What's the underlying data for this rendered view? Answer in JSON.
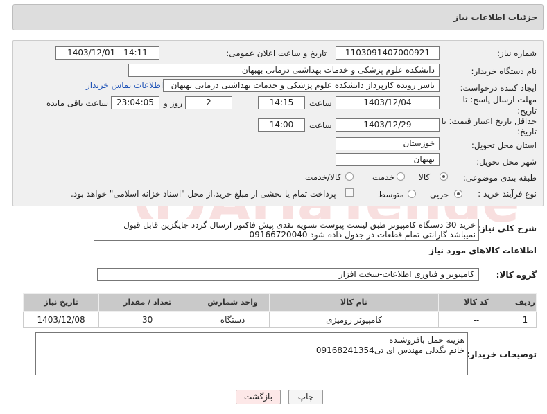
{
  "header": {
    "title": "جزئیات اطلاعات نیاز"
  },
  "form": {
    "need_number_label": "شماره نیاز:",
    "need_number": "1103091407000921",
    "announce_label": "تاریخ و ساعت اعلان عمومی:",
    "announce_value": "1403/12/01 - 14:11",
    "buyer_org_label": "نام دستگاه خریدار:",
    "buyer_org": "دانشکده علوم پزشکی و خدمات بهداشتی  درمانی بهبهان",
    "creator_label": "ایجاد کننده درخواست:",
    "creator": "یاسر رونده کارپرداز دانشکده علوم پزشکی و خدمات بهداشتی  درمانی بهبهان",
    "contact_link": "اطلاعات تماس خریدار",
    "deadline_label_1": "مهلت ارسال پاسخ: تا",
    "deadline_label_2": "تاریخ:",
    "deadline_date": "1403/12/04",
    "time_label": "ساعت",
    "deadline_time": "14:15",
    "days_value": "2",
    "days_label": "روز و",
    "remaining_time": "23:04:05",
    "remaining_label": "ساعت باقی مانده",
    "validity_label_1": "حداقل تاریخ اعتبار قیمت: تا",
    "validity_label_2": "تاریخ:",
    "validity_date": "1403/12/29",
    "validity_time": "14:00",
    "province_label": "استان محل تحویل:",
    "province": "خوزستان",
    "city_label": "شهر محل تحویل:",
    "city": "بهبهان",
    "category_label": "طبقه بندی موضوعی:",
    "category_options": [
      "کالا",
      "خدمت",
      "کالا/خدمت"
    ],
    "process_label": "نوع فرآیند خرید :",
    "process_options": [
      "جزیی",
      "متوسط"
    ],
    "payment_note": "پرداخت تمام یا بخشی از مبلغ خرید،از محل \"اسناد خزانه اسلامی\" خواهد بود."
  },
  "description": {
    "label": "شرح کلی نیاز:",
    "text": "خرید 30 دستگاه کامپیوتر طبق لیست پیوست تسویه نقدی پیش فاکتور ارسال گردد جایگزین قابل قبول نمیباشد گارانتی تمام قطعات در جدول داده شود 09166720040"
  },
  "goods": {
    "section_title": "اطلاعات کالاهای مورد نیاز",
    "group_label": "گروه کالا:",
    "group_value": "کامپیوتر و فناوری اطلاعات-سخت افزار",
    "columns": [
      "ردیف",
      "کد کالا",
      "نام کالا",
      "واحد شمارش",
      "تعداد / مقدار",
      "تاریخ نیاز"
    ],
    "rows": [
      {
        "row": "1",
        "code": "--",
        "name": "کامپیوتر رومیزی",
        "unit": "دستگاه",
        "qty": "30",
        "date": "1403/12/08"
      }
    ]
  },
  "buyer_notes": {
    "label": "توضیحات خریدار:",
    "line1": "هزینه حمل بافروشنده",
    "line2": "خانم بگدلی مهندس ای تی09168241354"
  },
  "buttons": {
    "print": "چاپ",
    "back": "بازگشت"
  },
  "colors": {
    "back_button_bg": "#fde8e8",
    "link": "#1a4fb5",
    "header_bg": "#dddddd"
  }
}
